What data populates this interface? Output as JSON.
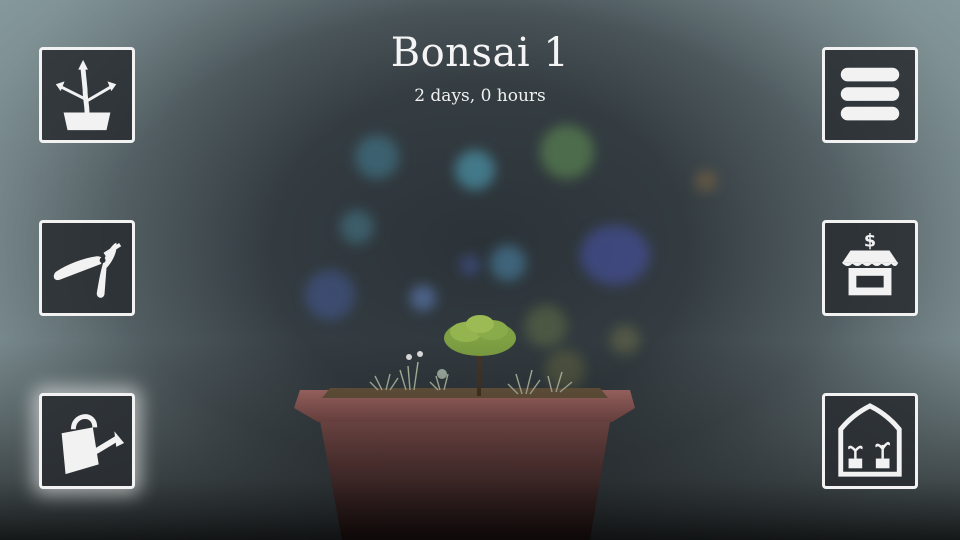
{
  "header": {
    "tree_name": "Bonsai 1",
    "age": "2 days, 0 hours"
  },
  "left_toolbar": [
    {
      "id": "grow",
      "icon": "tree-growth-icon"
    },
    {
      "id": "prune",
      "icon": "pruning-shears-icon"
    },
    {
      "id": "water",
      "icon": "watering-can-icon",
      "highlighted": true
    }
  ],
  "right_toolbar": [
    {
      "id": "menu",
      "icon": "menu-icon"
    },
    {
      "id": "shop",
      "icon": "shop-icon"
    },
    {
      "id": "greenhouse",
      "icon": "greenhouse-icon"
    }
  ],
  "colors": {
    "button_border": "#f2f2f2",
    "button_fill": "#2c3034",
    "pot": "#a86a66",
    "foliage": "#7fa043"
  }
}
